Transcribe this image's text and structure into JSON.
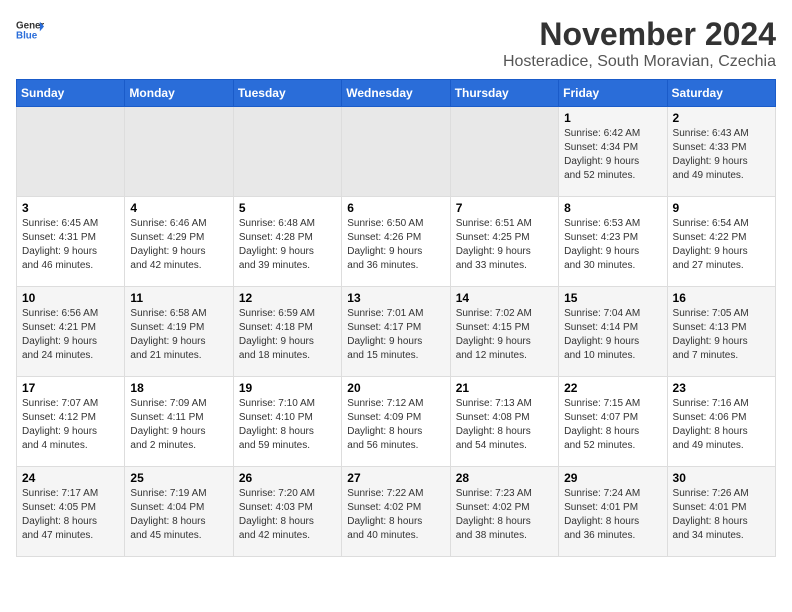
{
  "logo": {
    "text_general": "General",
    "text_blue": "Blue",
    "arrow_color": "#2a6dd9"
  },
  "title": "November 2024",
  "subtitle": "Hosteradice, South Moravian, Czechia",
  "days_of_week": [
    "Sunday",
    "Monday",
    "Tuesday",
    "Wednesday",
    "Thursday",
    "Friday",
    "Saturday"
  ],
  "weeks": [
    {
      "days": [
        {
          "num": "",
          "info": ""
        },
        {
          "num": "",
          "info": ""
        },
        {
          "num": "",
          "info": ""
        },
        {
          "num": "",
          "info": ""
        },
        {
          "num": "",
          "info": ""
        },
        {
          "num": "1",
          "info": "Sunrise: 6:42 AM\nSunset: 4:34 PM\nDaylight: 9 hours\nand 52 minutes."
        },
        {
          "num": "2",
          "info": "Sunrise: 6:43 AM\nSunset: 4:33 PM\nDaylight: 9 hours\nand 49 minutes."
        }
      ]
    },
    {
      "days": [
        {
          "num": "3",
          "info": "Sunrise: 6:45 AM\nSunset: 4:31 PM\nDaylight: 9 hours\nand 46 minutes."
        },
        {
          "num": "4",
          "info": "Sunrise: 6:46 AM\nSunset: 4:29 PM\nDaylight: 9 hours\nand 42 minutes."
        },
        {
          "num": "5",
          "info": "Sunrise: 6:48 AM\nSunset: 4:28 PM\nDaylight: 9 hours\nand 39 minutes."
        },
        {
          "num": "6",
          "info": "Sunrise: 6:50 AM\nSunset: 4:26 PM\nDaylight: 9 hours\nand 36 minutes."
        },
        {
          "num": "7",
          "info": "Sunrise: 6:51 AM\nSunset: 4:25 PM\nDaylight: 9 hours\nand 33 minutes."
        },
        {
          "num": "8",
          "info": "Sunrise: 6:53 AM\nSunset: 4:23 PM\nDaylight: 9 hours\nand 30 minutes."
        },
        {
          "num": "9",
          "info": "Sunrise: 6:54 AM\nSunset: 4:22 PM\nDaylight: 9 hours\nand 27 minutes."
        }
      ]
    },
    {
      "days": [
        {
          "num": "10",
          "info": "Sunrise: 6:56 AM\nSunset: 4:21 PM\nDaylight: 9 hours\nand 24 minutes."
        },
        {
          "num": "11",
          "info": "Sunrise: 6:58 AM\nSunset: 4:19 PM\nDaylight: 9 hours\nand 21 minutes."
        },
        {
          "num": "12",
          "info": "Sunrise: 6:59 AM\nSunset: 4:18 PM\nDaylight: 9 hours\nand 18 minutes."
        },
        {
          "num": "13",
          "info": "Sunrise: 7:01 AM\nSunset: 4:17 PM\nDaylight: 9 hours\nand 15 minutes."
        },
        {
          "num": "14",
          "info": "Sunrise: 7:02 AM\nSunset: 4:15 PM\nDaylight: 9 hours\nand 12 minutes."
        },
        {
          "num": "15",
          "info": "Sunrise: 7:04 AM\nSunset: 4:14 PM\nDaylight: 9 hours\nand 10 minutes."
        },
        {
          "num": "16",
          "info": "Sunrise: 7:05 AM\nSunset: 4:13 PM\nDaylight: 9 hours\nand 7 minutes."
        }
      ]
    },
    {
      "days": [
        {
          "num": "17",
          "info": "Sunrise: 7:07 AM\nSunset: 4:12 PM\nDaylight: 9 hours\nand 4 minutes."
        },
        {
          "num": "18",
          "info": "Sunrise: 7:09 AM\nSunset: 4:11 PM\nDaylight: 9 hours\nand 2 minutes."
        },
        {
          "num": "19",
          "info": "Sunrise: 7:10 AM\nSunset: 4:10 PM\nDaylight: 8 hours\nand 59 minutes."
        },
        {
          "num": "20",
          "info": "Sunrise: 7:12 AM\nSunset: 4:09 PM\nDaylight: 8 hours\nand 56 minutes."
        },
        {
          "num": "21",
          "info": "Sunrise: 7:13 AM\nSunset: 4:08 PM\nDaylight: 8 hours\nand 54 minutes."
        },
        {
          "num": "22",
          "info": "Sunrise: 7:15 AM\nSunset: 4:07 PM\nDaylight: 8 hours\nand 52 minutes."
        },
        {
          "num": "23",
          "info": "Sunrise: 7:16 AM\nSunset: 4:06 PM\nDaylight: 8 hours\nand 49 minutes."
        }
      ]
    },
    {
      "days": [
        {
          "num": "24",
          "info": "Sunrise: 7:17 AM\nSunset: 4:05 PM\nDaylight: 8 hours\nand 47 minutes."
        },
        {
          "num": "25",
          "info": "Sunrise: 7:19 AM\nSunset: 4:04 PM\nDaylight: 8 hours\nand 45 minutes."
        },
        {
          "num": "26",
          "info": "Sunrise: 7:20 AM\nSunset: 4:03 PM\nDaylight: 8 hours\nand 42 minutes."
        },
        {
          "num": "27",
          "info": "Sunrise: 7:22 AM\nSunset: 4:02 PM\nDaylight: 8 hours\nand 40 minutes."
        },
        {
          "num": "28",
          "info": "Sunrise: 7:23 AM\nSunset: 4:02 PM\nDaylight: 8 hours\nand 38 minutes."
        },
        {
          "num": "29",
          "info": "Sunrise: 7:24 AM\nSunset: 4:01 PM\nDaylight: 8 hours\nand 36 minutes."
        },
        {
          "num": "30",
          "info": "Sunrise: 7:26 AM\nSunset: 4:01 PM\nDaylight: 8 hours\nand 34 minutes."
        }
      ]
    }
  ]
}
